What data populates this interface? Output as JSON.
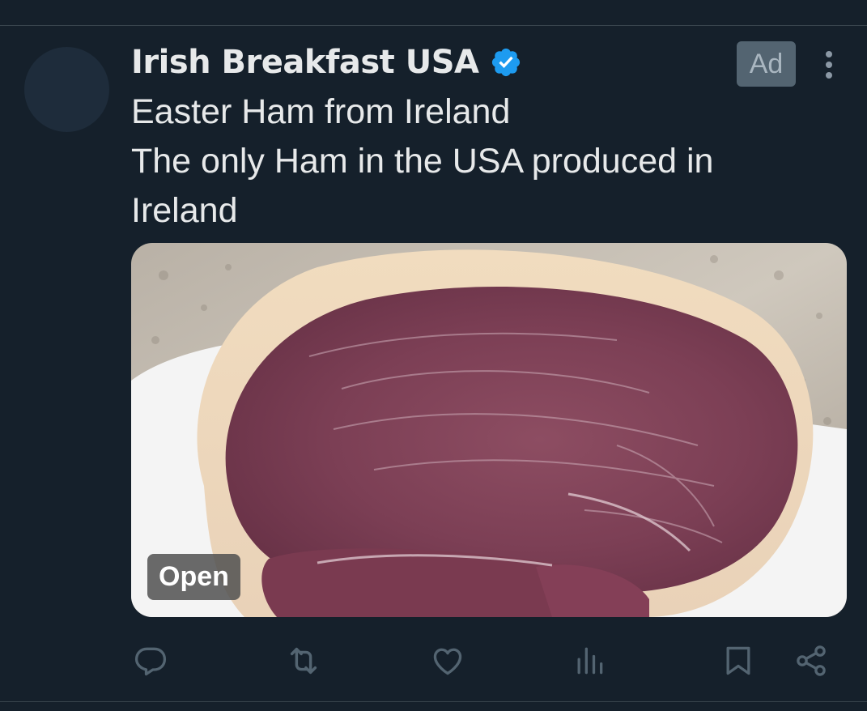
{
  "tweet": {
    "author_name": "Irish Breakfast USA",
    "ad_label": "Ad",
    "text_lines": [
      "Easter Ham from Ireland",
      "The only Ham in the USA produced in",
      "Ireland"
    ],
    "media": {
      "open_label": "Open"
    }
  },
  "colors": {
    "background": "#15202b",
    "verified_blue": "#1d9bf0",
    "icon_gray": "#536471"
  },
  "icons": {
    "verified": "verified-badge-icon",
    "more": "more-dots-icon",
    "reply": "reply-icon",
    "retweet": "retweet-icon",
    "like": "heart-icon",
    "views": "views-chart-icon",
    "bookmark": "bookmark-icon",
    "share": "share-icon"
  }
}
